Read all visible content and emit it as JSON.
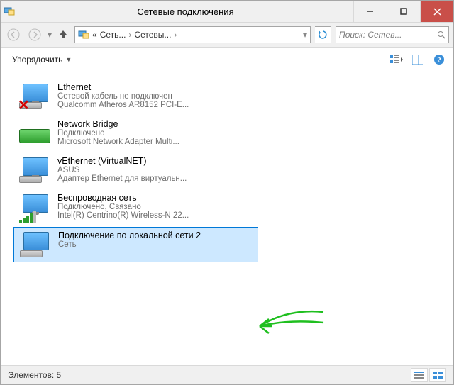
{
  "window": {
    "title": "Сетевые подключения"
  },
  "nav": {
    "address_prefix": "«",
    "crumb1": "Сеть...",
    "crumb2": "Сетевы...",
    "search_placeholder": "Поиск: Сетев..."
  },
  "toolbar": {
    "organize": "Упорядочить"
  },
  "connections": [
    {
      "name": "Ethernet",
      "status": "Сетевой кабель не подключен",
      "device": "Qualcomm Atheros AR8152 PCI-E...",
      "icon": "ethernet-disconnected",
      "selected": false
    },
    {
      "name": "Network Bridge",
      "status": "Подключено",
      "device": "Microsoft Network Adapter Multi...",
      "icon": "bridge",
      "selected": false
    },
    {
      "name": "vEthernet (VirtualNET)",
      "status": "ASUS",
      "device": "Адаптер Ethernet для виртуальн...",
      "icon": "ethernet",
      "selected": false
    },
    {
      "name": "Беспроводная сеть",
      "status": "Подключено, Связано",
      "device": "Intel(R) Centrino(R) Wireless-N 22...",
      "icon": "wifi",
      "selected": false
    },
    {
      "name": "Подключение по локальной сети 2",
      "status": "",
      "device": "Сеть",
      "icon": "ethernet",
      "selected": true
    }
  ],
  "status": {
    "count_label": "Элементов:",
    "count_value": "5"
  }
}
